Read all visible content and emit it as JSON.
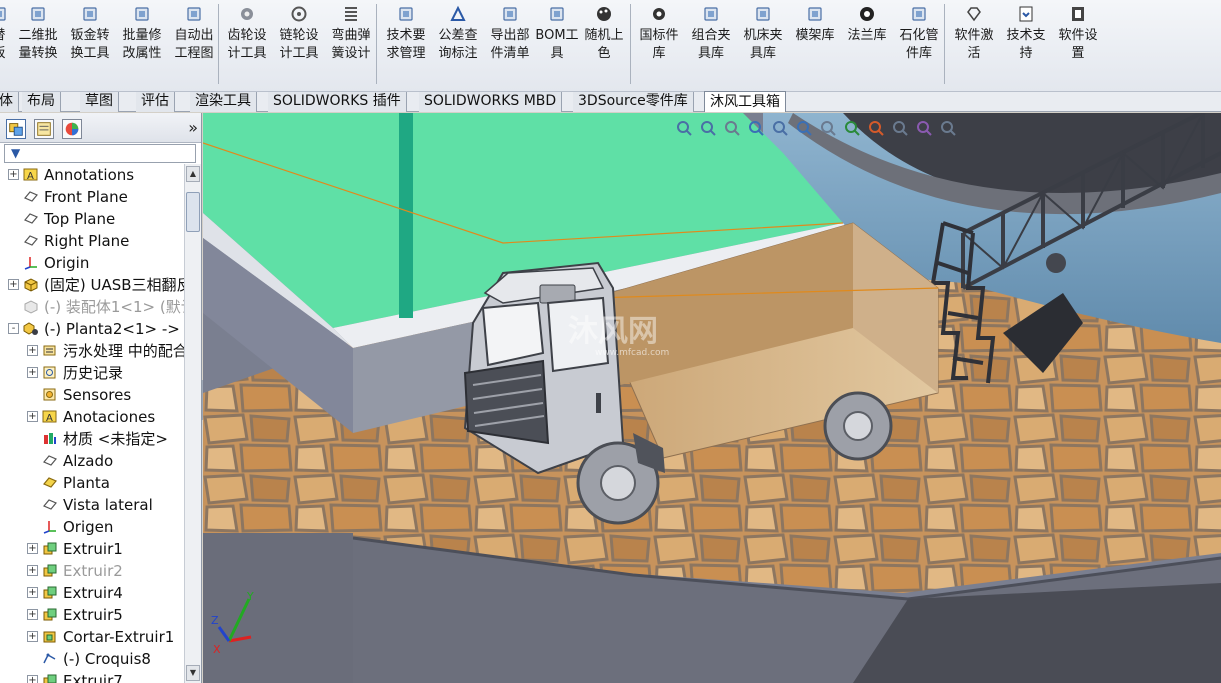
{
  "ribbon": {
    "buttons": [
      {
        "label": "替\n板",
        "icon": "partial-icon"
      },
      {
        "label": "二维批量转换",
        "icon": "batch-convert-icon"
      },
      {
        "label": "钣金转换工具",
        "icon": "sheetmetal-icon"
      },
      {
        "label": "批量修改属性",
        "icon": "batch-edit-icon"
      },
      {
        "label": "自动出工程图",
        "icon": "drawing-icon"
      },
      {
        "label": "齿轮设计工具",
        "icon": "gear-icon"
      },
      {
        "label": "链轮设计工具",
        "icon": "sprocket-icon"
      },
      {
        "label": "弯曲弹簧设计",
        "icon": "spring-icon"
      },
      {
        "label": "技术要求管理",
        "icon": "tech-req-icon"
      },
      {
        "label": "公差查询标注",
        "icon": "tolerance-icon"
      },
      {
        "label": "导出部件清单",
        "icon": "export-list-icon"
      },
      {
        "label": "BOM工具",
        "icon": "bom-icon"
      },
      {
        "label": "随机上色",
        "icon": "palette-icon"
      },
      {
        "label": "国标件库",
        "icon": "standard-parts-icon"
      },
      {
        "label": "组合夹具库",
        "icon": "fixture-icon"
      },
      {
        "label": "机床夹具库",
        "icon": "machine-fixture-icon"
      },
      {
        "label": "模架库",
        "icon": "mold-base-icon"
      },
      {
        "label": "法兰库",
        "icon": "flange-icon"
      },
      {
        "label": "石化管件库",
        "icon": "pipe-fitting-icon"
      },
      {
        "label": "软件激活",
        "icon": "diamond-icon"
      },
      {
        "label": "技术支持",
        "icon": "support-icon"
      },
      {
        "label": "软件设置",
        "icon": "settings-icon"
      }
    ]
  },
  "command_tabs": [
    {
      "label": "体"
    },
    {
      "label": "布局"
    },
    {
      "label": "草图"
    },
    {
      "label": "评估"
    },
    {
      "label": "渲染工具"
    },
    {
      "label": "SOLIDWORKS 插件"
    },
    {
      "label": "SOLIDWORKS MBD"
    },
    {
      "label": "3DSource零件库"
    },
    {
      "label": "沐风工具箱",
      "active": true
    }
  ],
  "feature_manager": {
    "collapse_label": "»",
    "filter_label": "▼",
    "tree": [
      {
        "label": "Annotations",
        "icon": "annotation-icon",
        "level": 0,
        "expander": "+"
      },
      {
        "label": "Front Plane",
        "icon": "plane-icon",
        "level": 0,
        "expander": ""
      },
      {
        "label": "Top Plane",
        "icon": "plane-icon",
        "level": 0,
        "expander": ""
      },
      {
        "label": "Right Plane",
        "icon": "plane-icon",
        "level": 0,
        "expander": ""
      },
      {
        "label": "Origin",
        "icon": "origin-icon",
        "level": 0,
        "expander": ""
      },
      {
        "label": "(固定) UASB三相翻反",
        "icon": "part-icon",
        "level": 0,
        "expander": "+"
      },
      {
        "label": "(-) 装配体1<1> (默认",
        "icon": "assembly-dim-icon",
        "level": 0,
        "expander": "",
        "dim": true
      },
      {
        "label": "(-) Planta2<1> ->",
        "icon": "part-ref-icon",
        "level": 0,
        "expander": "-"
      },
      {
        "label": "污水处理 中的配合",
        "icon": "mates-icon",
        "level": 1,
        "expander": "+"
      },
      {
        "label": "历史记录",
        "icon": "history-icon",
        "level": 1,
        "expander": "+"
      },
      {
        "label": "Sensores",
        "icon": "sensor-icon",
        "level": 1,
        "expander": ""
      },
      {
        "label": "Anotaciones",
        "icon": "annotation-icon",
        "level": 1,
        "expander": "+"
      },
      {
        "label": "材质 <未指定>",
        "icon": "material-icon",
        "level": 1,
        "expander": ""
      },
      {
        "label": "Alzado",
        "icon": "plane-icon",
        "level": 1,
        "expander": ""
      },
      {
        "label": "Planta",
        "icon": "plane-selected-icon",
        "level": 1,
        "expander": ""
      },
      {
        "label": "Vista lateral",
        "icon": "plane-icon",
        "level": 1,
        "expander": ""
      },
      {
        "label": "Origen",
        "icon": "origin-icon",
        "level": 1,
        "expander": ""
      },
      {
        "label": "Extruir1",
        "icon": "extrude-icon",
        "level": 1,
        "expander": "+"
      },
      {
        "label": "Extruir2",
        "icon": "extrude-icon",
        "level": 1,
        "expander": "+",
        "dim": true
      },
      {
        "label": "Extruir4",
        "icon": "extrude-icon",
        "level": 1,
        "expander": "+"
      },
      {
        "label": "Extruir5",
        "icon": "extrude-icon",
        "level": 1,
        "expander": "+"
      },
      {
        "label": "Cortar-Extruir1",
        "icon": "cut-extrude-icon",
        "level": 1,
        "expander": "+"
      },
      {
        "label": "(-) Croquis8",
        "icon": "sketch-icon",
        "level": 1,
        "expander": ""
      },
      {
        "label": "Extruir7",
        "icon": "extrude-icon",
        "level": 1,
        "expander": "+"
      }
    ]
  },
  "viewport": {
    "watermark": "沐风网",
    "watermark_sub": "www.mfcad.com",
    "triad": {
      "x": "X",
      "y": "Y",
      "z": "Z"
    },
    "hud_icons": [
      "zoom-fit-icon",
      "zoom-area-icon",
      "previous-view-icon",
      "section-view-icon",
      "view-orientation-icon",
      "display-style-icon",
      "hide-show-icon",
      "edit-appearance-icon",
      "apply-scene-icon",
      "view-settings-icon",
      "realview-icon",
      "screen-capture-icon"
    ],
    "colors": {
      "tank_water": "#5fe0a6",
      "stone_floor": "#c9935a",
      "truck_cab": "#c8cbd2",
      "truck_bed": "#d9b98e",
      "background_sky": "#6f9dbf"
    }
  }
}
